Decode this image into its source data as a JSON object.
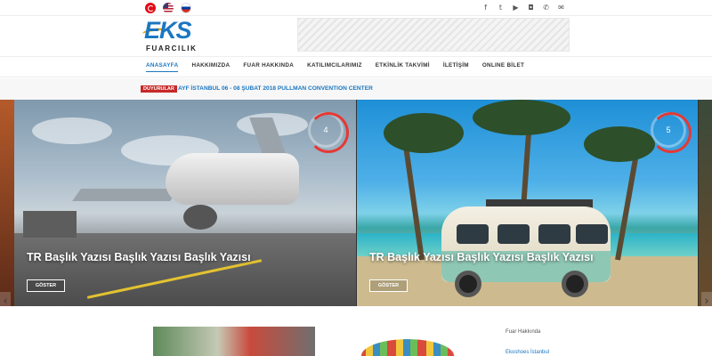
{
  "topbar": {
    "flags": [
      "turkish-flag",
      "us-flag",
      "russian-flag"
    ],
    "social_icons": [
      "facebook-icon",
      "twitter-icon",
      "youtube-icon",
      "instagram-icon",
      "phone-icon",
      "mail-icon"
    ],
    "social_glyphs": [
      "f",
      "t",
      "▶",
      "◘",
      "✆",
      "✉"
    ]
  },
  "header": {
    "logo_main": "EKS",
    "logo_sub": "FUARCILIK"
  },
  "nav": {
    "items": [
      "ANASAYFA",
      "HAKKIMIZDA",
      "FUAR HAKKINDA",
      "KATILIMCILARIMIZ",
      "ETKİNLİK TAKVİMİ",
      "İLETİŞİM",
      "ONLINE BİLET"
    ],
    "active_index": 0
  },
  "announcement": {
    "badge": "DUYURULAR",
    "text": "AYF İSTANBUL 06 - 08 ŞUBAT 2018 PULLMAN CONVENTION CENTER"
  },
  "slider": {
    "slides": [
      {
        "title": "TR Başlık Yazısı Başlık Yazısı Başlık Yazısı",
        "button": "GÖSTER",
        "counter": "4"
      },
      {
        "title": "TR Başlık Yazısı Başlık Yazısı Başlık Yazısı",
        "button": "GÖSTER",
        "counter": "5"
      }
    ],
    "arrow_left": "‹",
    "arrow_right": "›"
  },
  "sidebar": {
    "title": "Fuar Hakkında",
    "link": "Ekoshoes İstanbul"
  },
  "colors": {
    "accent": "#1a77c2",
    "badge": "#c62828",
    "counter_ring": "#e53935"
  }
}
